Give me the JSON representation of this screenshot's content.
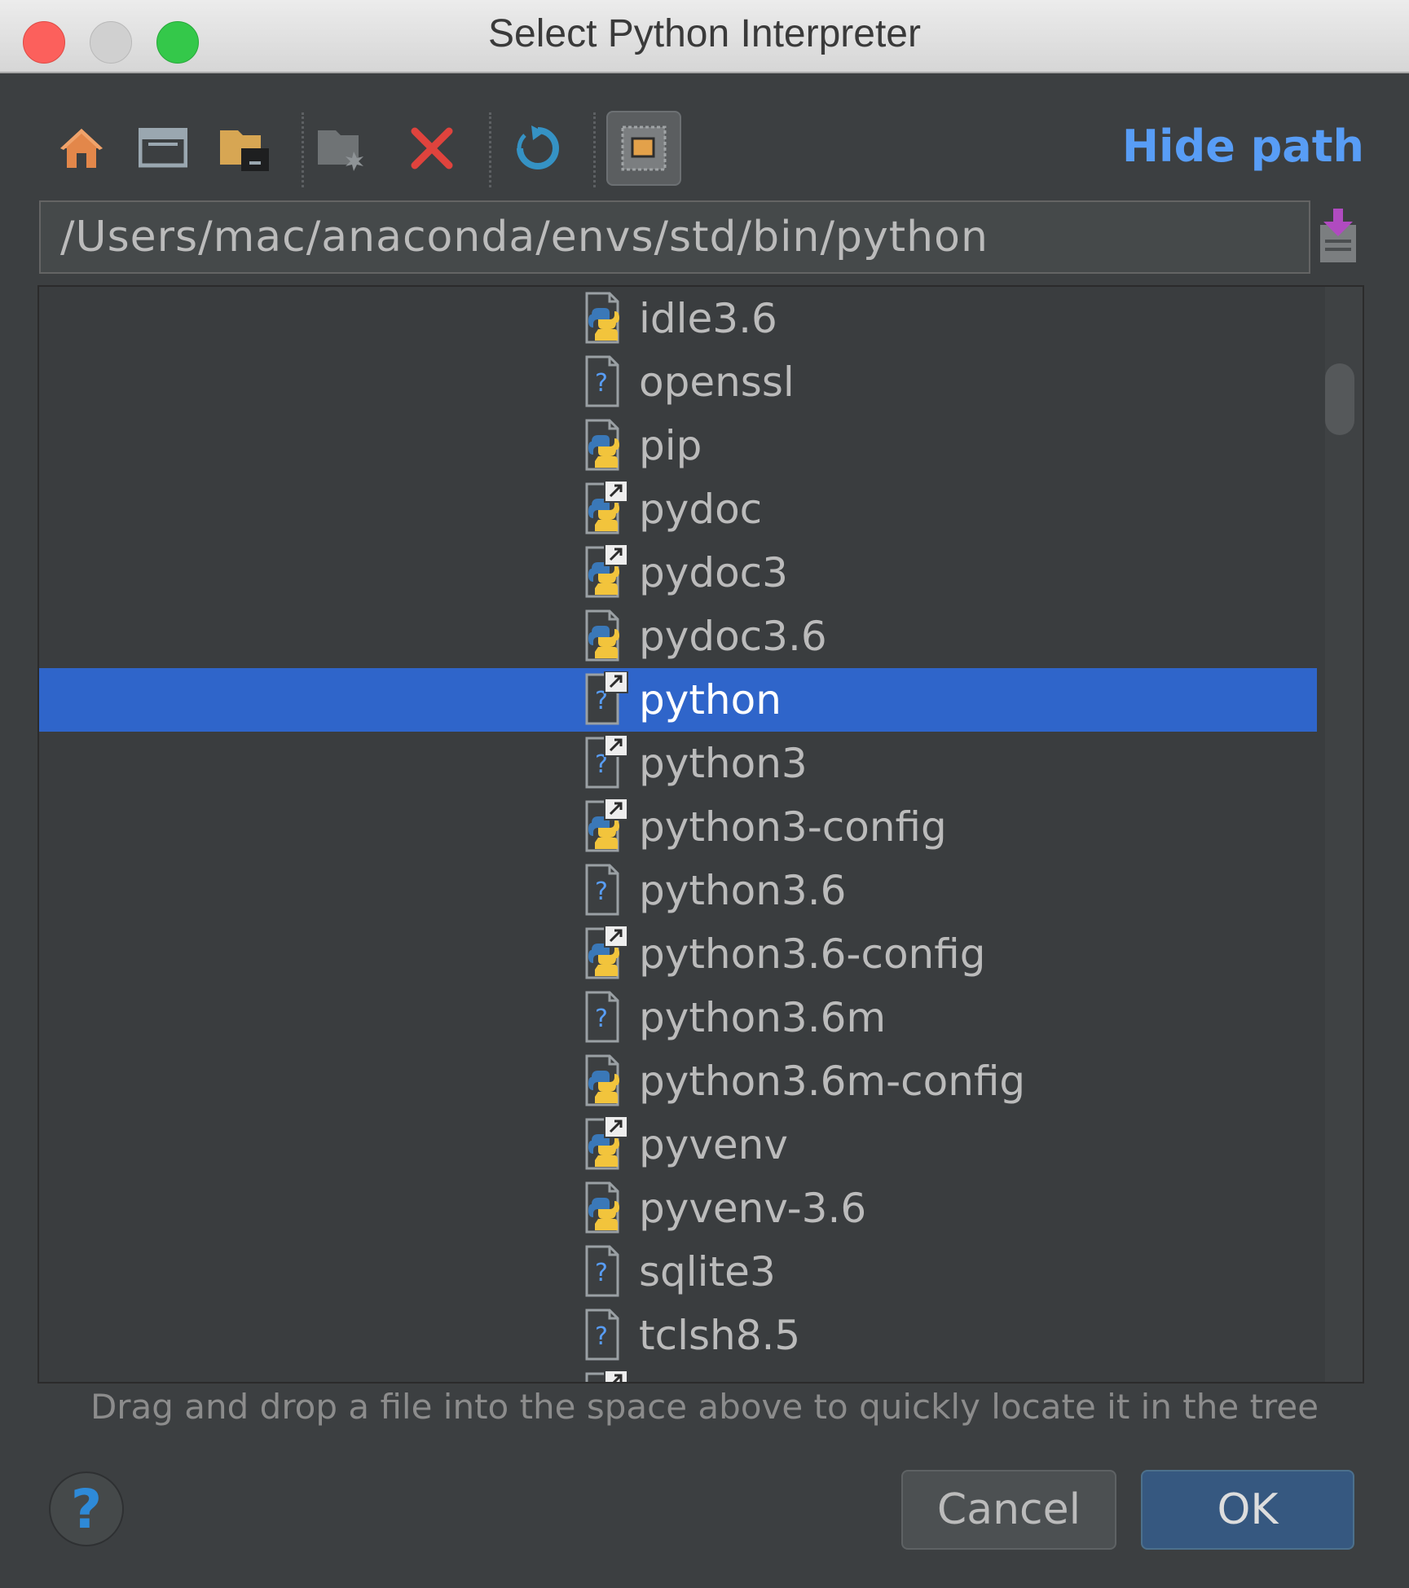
{
  "window": {
    "title": "Select Python Interpreter"
  },
  "toolbar": {
    "buttons": [
      {
        "name": "home-icon"
      },
      {
        "name": "desktop-icon"
      },
      {
        "name": "project-folder-icon"
      },
      {
        "name": "new-folder-icon"
      },
      {
        "name": "delete-icon"
      },
      {
        "name": "refresh-icon"
      },
      {
        "name": "show-hidden-icon"
      }
    ],
    "hide_path_label": "Hide path"
  },
  "path": {
    "value": "/Users/mac/anaconda/envs/std/bin/python"
  },
  "files": [
    {
      "name": "idle3.6",
      "icon": "python-file-icon",
      "link": false,
      "selected": false
    },
    {
      "name": "openssl",
      "icon": "unknown-file-icon",
      "link": false,
      "selected": false
    },
    {
      "name": "pip",
      "icon": "python-file-icon",
      "link": false,
      "selected": false
    },
    {
      "name": "pydoc",
      "icon": "python-file-icon",
      "link": true,
      "selected": false
    },
    {
      "name": "pydoc3",
      "icon": "python-file-icon",
      "link": true,
      "selected": false
    },
    {
      "name": "pydoc3.6",
      "icon": "python-file-icon",
      "link": false,
      "selected": false
    },
    {
      "name": "python",
      "icon": "unknown-file-icon",
      "link": true,
      "selected": true
    },
    {
      "name": "python3",
      "icon": "unknown-file-icon",
      "link": true,
      "selected": false
    },
    {
      "name": "python3-config",
      "icon": "python-file-icon",
      "link": true,
      "selected": false
    },
    {
      "name": "python3.6",
      "icon": "unknown-file-icon",
      "link": false,
      "selected": false
    },
    {
      "name": "python3.6-config",
      "icon": "python-file-icon",
      "link": true,
      "selected": false
    },
    {
      "name": "python3.6m",
      "icon": "unknown-file-icon",
      "link": false,
      "selected": false
    },
    {
      "name": "python3.6m-config",
      "icon": "python-file-icon",
      "link": false,
      "selected": false
    },
    {
      "name": "pyvenv",
      "icon": "python-file-icon",
      "link": true,
      "selected": false
    },
    {
      "name": "pyvenv-3.6",
      "icon": "python-file-icon",
      "link": false,
      "selected": false
    },
    {
      "name": "sqlite3",
      "icon": "unknown-file-icon",
      "link": false,
      "selected": false
    },
    {
      "name": "tclsh8.5",
      "icon": "unknown-file-icon",
      "link": false,
      "selected": false
    },
    {
      "name": "",
      "icon": "unknown-file-icon",
      "link": true,
      "selected": false
    }
  ],
  "hint": "Drag and drop a file into the space above to quickly locate it in the tree",
  "buttons": {
    "help": "?",
    "cancel": "Cancel",
    "ok": "OK"
  },
  "colors": {
    "selection": "#2f65ca",
    "link": "#589df6",
    "background": "#3c3f41"
  }
}
